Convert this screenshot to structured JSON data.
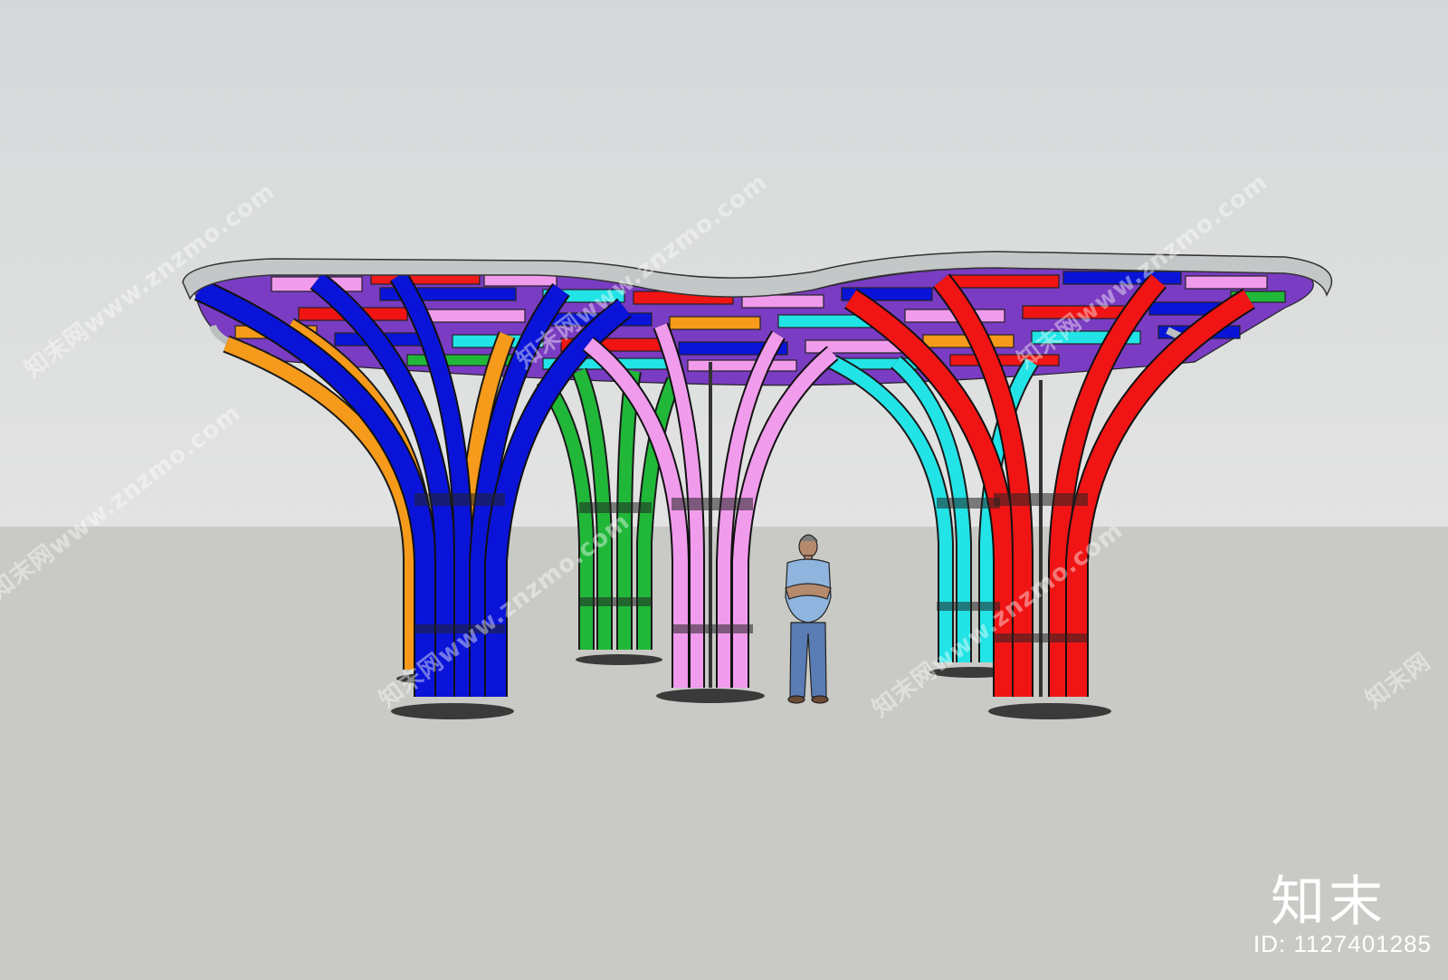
{
  "watermarks": {
    "site_text": "知末网www.znzmo.com",
    "short_text": "知末网"
  },
  "brand": {
    "logo_text": "知末"
  },
  "footer": {
    "id_text": "ID: 1127401285"
  },
  "colors": {
    "sky": "#d9dbdb",
    "ground": "#c9cac5",
    "canopy_rim": "#c4c7c8",
    "blue": "#0a14d8",
    "orange": "#f59a1a",
    "green": "#21b83a",
    "pink": "#f09bec",
    "cyan": "#22e3e6",
    "red": "#f01414"
  }
}
